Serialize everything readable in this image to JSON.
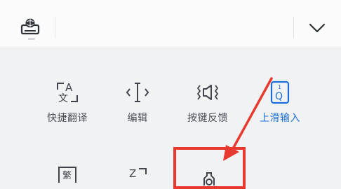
{
  "toolbar": {
    "keyboard_icon": "globe-keyboard-icon",
    "collapse_icon": "chevron-down-icon"
  },
  "panel": {
    "items": [
      {
        "label": "快捷翻译",
        "icon": "translate-icon"
      },
      {
        "label": "编辑",
        "icon": "text-cursor-icon"
      },
      {
        "label": "按键反馈",
        "icon": "speaker-vibrate-icon"
      },
      {
        "label": "上滑输入",
        "icon": "swipe-up-key-icon",
        "active": true
      }
    ],
    "row2": [
      {
        "label": "繁",
        "icon": "traditional-chinese-icon"
      },
      {
        "label": "Z",
        "icon": "zoom-icon"
      },
      {
        "label": "",
        "icon": "gear-icon"
      }
    ],
    "swipe_key_digit": "1",
    "swipe_key_letter": "Q"
  },
  "colors": {
    "accent": "#1d6fd6",
    "annotation": "#e8392f",
    "icon": "#3f434a"
  }
}
